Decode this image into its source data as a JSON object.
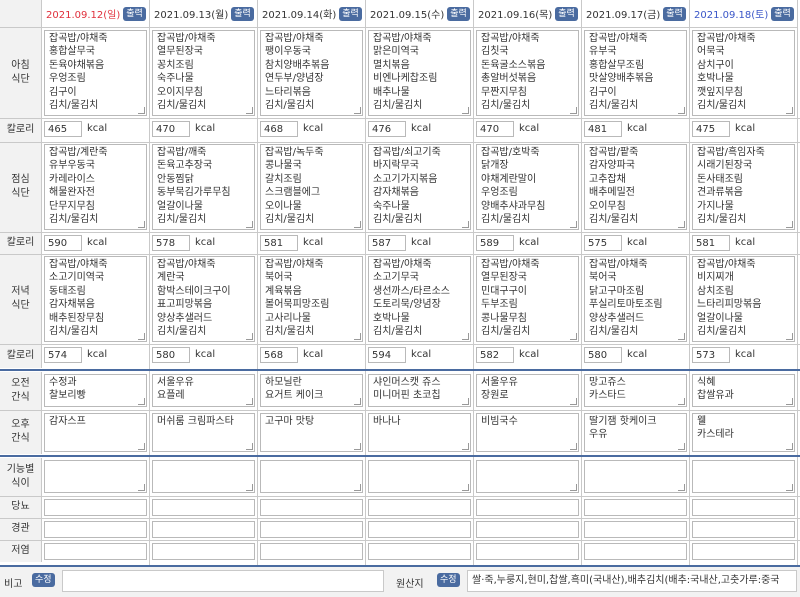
{
  "header": {
    "print_label": "출력",
    "days": [
      {
        "date": "2021.09.12(일)",
        "color": "#e0303c"
      },
      {
        "date": "2021.09.13(월)",
        "color": "#333333"
      },
      {
        "date": "2021.09.14(화)",
        "color": "#333333"
      },
      {
        "date": "2021.09.15(수)",
        "color": "#333333"
      },
      {
        "date": "2021.09.16(목)",
        "color": "#333333"
      },
      {
        "date": "2021.09.17(금)",
        "color": "#333333"
      },
      {
        "date": "2021.09.18(토)",
        "color": "#3a56c8"
      }
    ]
  },
  "labels": {
    "breakfast": "아침\n식단",
    "lunch": "점심\n식단",
    "dinner": "저녁\n식단",
    "calorie": "칼로리",
    "snack_am": "오전\n간식",
    "snack_pm": "오후\n간식",
    "functional": "기능별\n식이",
    "diabetic": "당뇨",
    "tube": "경관",
    "lowsalt": "저염",
    "note": "비고",
    "origin": "원산지",
    "edit": "수정",
    "kcal": "kcal"
  },
  "breakfast": [
    "잡곡밥/야채죽\n홍합살무국\n돈육야채볶음\n우엉조림\n김구이\n김치/물김치",
    "잡곡밥/야채죽\n열무된장국\n꽁치조림\n숙주나물\n오이지무침\n김치/물김치",
    "잡곡밥/야채죽\n팽이우동국\n참치양배추볶음\n연두부/양념장\n느타리볶음\n김치/물김치",
    "잡곡밥/야채죽\n맑은미역국\n멸치볶음\n비엔나케찹조림\n배추나물\n김치/물김치",
    "잡곡밥/야채죽\n김칫국\n돈육굴소스볶음\n총알버섯볶음\n무짠지무침\n김치/물김치",
    "잡곡밥/야채죽\n유부국\n홍합살무조림\n맛살양배추볶음\n김구이\n김치/물김치",
    "잡곡밥/야채죽\n어묵국\n삼치구이\n호박나물\n깻잎지무침\n김치/물김치"
  ],
  "breakfast_kcal": [
    "465",
    "470",
    "468",
    "476",
    "470",
    "481",
    "475"
  ],
  "lunch": [
    "잡곡밥/계란죽\n유부우동국\n카레라이스\n해물완자전\n단무지무침\n김치/물김치",
    "잡곡밥/깨죽\n돈육고추장국\n안동찜닭\n동부묵김가루무침\n얼갈이나물\n김치/물김치",
    "잡곡밥/녹두죽\n콩나물국\n갈치조림\n스크램블에그\n오이나물\n김치/물김치",
    "잡곡밥/쇠고기죽\n바지락무국\n소고기가지볶음\n감자채볶음\n숙주나물\n김치/물김치",
    "잡곡밥/호박죽\n닭개장\n야채계란말이\n우엉조림\n양배추샤과무침\n김치/물김치",
    "잡곡밥/팥죽\n감자양파국\n고추잡채\n배추메밀전\n오이무침\n김치/물김치",
    "잡곡밥/흑임자죽\n시래기된장국\n돈사태조림\n견과류볶음\n가지나물\n김치/물김치"
  ],
  "lunch_kcal": [
    "590",
    "578",
    "581",
    "587",
    "589",
    "575",
    "581"
  ],
  "dinner": [
    "잡곡밥/야채죽\n소고기미역국\n동태조림\n감자채볶음\n배추된장무침\n김치/물김치",
    "잡곡밥/야채죽\n계란국\n함박스테이크구이\n표고피망볶음\n양상추샐러드\n김치/물김치",
    "잡곡밥/야채죽\n북어국\n계육볶음\n볼어묵피망조림\n고사리나물\n김치/물김치",
    "잡곡밥/야채죽\n소고기무국\n생선까스/타르소스\n도토리묵/양념장\n호박나물\n김치/물김치",
    "잡곡밥/야채죽\n열무된장국\n민대구구이\n두부조림\n콩나물무침\n김치/물김치",
    "잡곡밥/야채죽\n북어국\n닭고구마조림\n푸실리토마토조림\n양상추샐러드\n김치/물김치",
    "잡곡밥/야채죽\n비지찌개\n삼치조림\n느타리피망볶음\n얼갈이나물\n김치/물김치"
  ],
  "dinner_kcal": [
    "574",
    "580",
    "568",
    "594",
    "582",
    "580",
    "573"
  ],
  "snack_am": [
    "수정과\n찰보리빵",
    "서울우유\n요플레",
    "하모닐란\n요거트 케이크",
    "샤인머스캣 쥬스\n미니머핀 초코칩",
    "서울우유\n장원로",
    "망고쥬스\n카스타드",
    "식혜\n찹쌀유과"
  ],
  "snack_pm": [
    "감자스프",
    "머쉬룸 크림파스타",
    "고구마 맛탕",
    "바나나",
    "비빔국수",
    "딸기잼 핫케이크\n우유",
    "웰\n카스테라"
  ],
  "footer": {
    "origin_text": "쌀·죽,누룽지,현미,찹쌀,흑미(국내산),배추김치(배추:국내산,고춧가루:중국"
  },
  "colors": {
    "accent": "#4a6ba0",
    "sunday": "#e0303c",
    "saturday": "#3a56c8"
  }
}
